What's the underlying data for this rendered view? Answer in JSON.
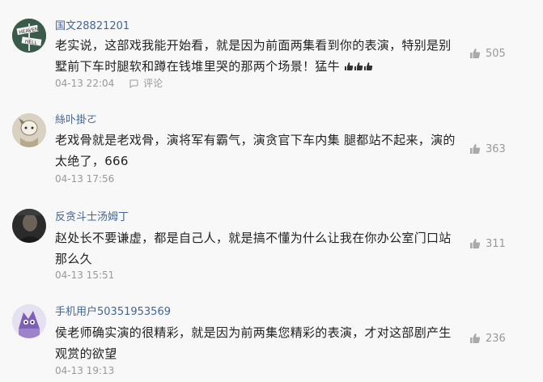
{
  "comments": [
    {
      "username": "国文28821201",
      "content": "老实说，这部戏我能开始看，就是因为前面两集看到你的表演，特别是别墅前下车时腿软和蹲在钱堆里哭的那两个场景！猛牛",
      "emoji": "thumbs-up-emoji",
      "emoji_count": 3,
      "time": "04-13 22:04",
      "reply_label": "评论",
      "likes": "505",
      "avatar_text": "HEAVEN HELL"
    },
    {
      "username": "絲卟掛ㄛ",
      "content": "老戏骨就是老戏骨，演将军有霸气，演贪官下车内集 腿都站不起来，演的太绝了，666",
      "time": "04-13 17:56",
      "likes": "363"
    },
    {
      "username": "反贪斗士汤姆丁",
      "content": "赵处长不要谦虚，都是自己人，就是搞不懂为什么让我在你办公室门口站那么久",
      "time": "04-13 15:51",
      "likes": "311"
    },
    {
      "username": "手机用户50351953569",
      "content": "侯老师确实演的很精彩，就是因为前两集您精彩的表演，才对这部剧产生观赏的欲望",
      "time": "04-13 19:13",
      "likes": "236"
    }
  ],
  "colors": {
    "background": "#f8f8f8",
    "username": "#406599",
    "text": "#222222",
    "meta": "#999999"
  }
}
